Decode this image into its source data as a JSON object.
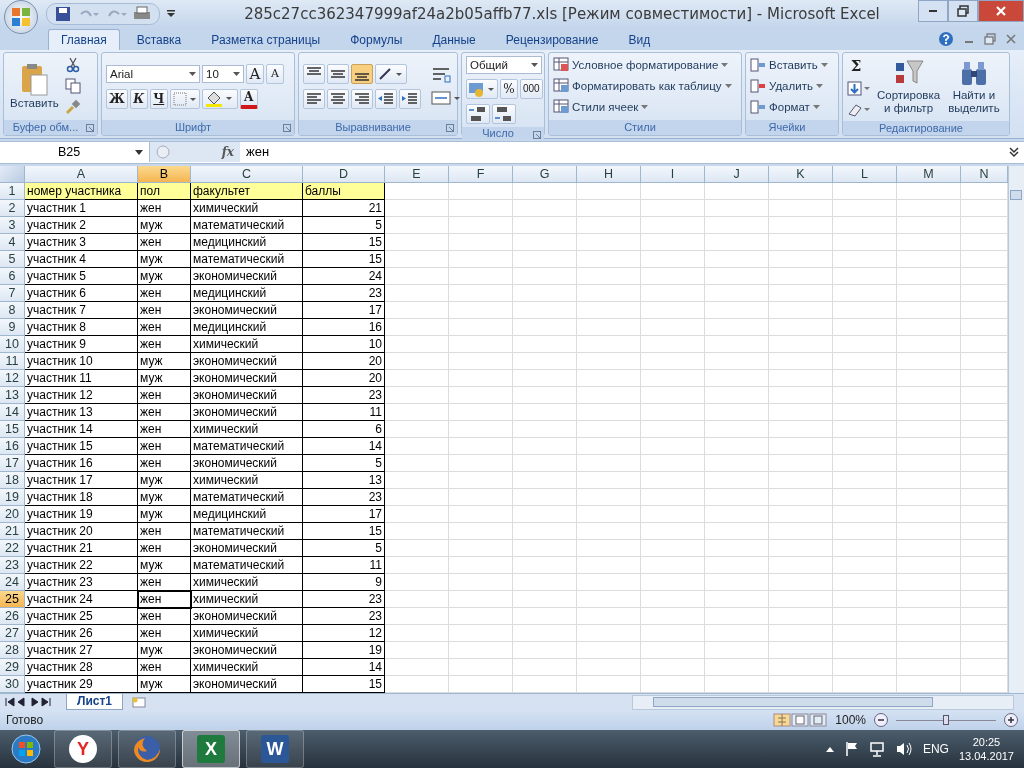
{
  "window": {
    "title": "285c27cc362347999af24a2b05affb77.xls  [Режим совместимости] - Microsoft Excel"
  },
  "ribbon_tabs": [
    {
      "label": "Главная",
      "selected": true
    },
    {
      "label": "Вставка",
      "selected": false
    },
    {
      "label": "Разметка страницы",
      "selected": false
    },
    {
      "label": "Формулы",
      "selected": false
    },
    {
      "label": "Данные",
      "selected": false
    },
    {
      "label": "Рецензирование",
      "selected": false
    },
    {
      "label": "Вид",
      "selected": false
    }
  ],
  "ribbon": {
    "clipboard": {
      "paste": "Вставить",
      "label": "Буфер обм..."
    },
    "font": {
      "family": "Arial",
      "size": "10",
      "grow": "A",
      "shrink": "A",
      "bold": "Ж",
      "italic": "К",
      "underline": "Ч",
      "font_color_letter": "A",
      "label": "Шрифт"
    },
    "alignment": {
      "label": "Выравнивание"
    },
    "number": {
      "format": "Общий",
      "percent": "%",
      "thousands": "000",
      "label": "Число"
    },
    "styles": {
      "items": [
        "Условное форматирование",
        "Форматировать как таблицу",
        "Стили ячеек"
      ],
      "label": "Стили"
    },
    "cells": {
      "items": [
        "Вставить",
        "Удалить",
        "Формат"
      ],
      "label": "Ячейки"
    },
    "editing": {
      "sum": "Σ",
      "sort": [
        "Сортировка",
        "и фильтр"
      ],
      "find": [
        "Найти и",
        "выделить"
      ],
      "label": "Редактирование"
    }
  },
  "formula_bar": {
    "name_box": "B25",
    "fx": "fx",
    "value": "жен"
  },
  "sheet": {
    "columns": [
      {
        "label": "A",
        "selected": false
      },
      {
        "label": "B",
        "selected": true
      },
      {
        "label": "C",
        "selected": false
      },
      {
        "label": "D",
        "selected": false
      },
      {
        "label": "E",
        "selected": false
      },
      {
        "label": "F",
        "selected": false
      },
      {
        "label": "G",
        "selected": false
      },
      {
        "label": "H",
        "selected": false
      },
      {
        "label": "I",
        "selected": false
      },
      {
        "label": "J",
        "selected": false
      },
      {
        "label": "K",
        "selected": false
      },
      {
        "label": "L",
        "selected": false
      },
      {
        "label": "M",
        "selected": false
      },
      {
        "label": "N",
        "selected": false
      }
    ],
    "rows": [
      {
        "number": "1",
        "selected": false,
        "kind": "header",
        "cells": [
          "номер участника",
          "пол",
          "факультет",
          "баллы"
        ]
      },
      {
        "number": "2",
        "selected": false,
        "kind": "data",
        "cells": [
          "участник 1",
          "жен",
          "химический",
          "21"
        ]
      },
      {
        "number": "3",
        "selected": false,
        "kind": "data",
        "cells": [
          "участник 2",
          "муж",
          "математический",
          "5"
        ]
      },
      {
        "number": "4",
        "selected": false,
        "kind": "data",
        "cells": [
          "участник 3",
          "жен",
          "медицинский",
          "15"
        ]
      },
      {
        "number": "5",
        "selected": false,
        "kind": "data",
        "cells": [
          "участник 4",
          "муж",
          "математический",
          "15"
        ]
      },
      {
        "number": "6",
        "selected": false,
        "kind": "data",
        "cells": [
          "участник 5",
          "муж",
          "экономический",
          "24"
        ]
      },
      {
        "number": "7",
        "selected": false,
        "kind": "data",
        "cells": [
          "участник 6",
          "жен",
          "медицинский",
          "23"
        ]
      },
      {
        "number": "8",
        "selected": false,
        "kind": "data",
        "cells": [
          "участник 7",
          "жен",
          "экономический",
          "17"
        ]
      },
      {
        "number": "9",
        "selected": false,
        "kind": "data",
        "cells": [
          "участник 8",
          "жен",
          "медицинский",
          "16"
        ]
      },
      {
        "number": "10",
        "selected": false,
        "kind": "data",
        "cells": [
          "участник 9",
          "жен",
          "химический",
          "10"
        ]
      },
      {
        "number": "11",
        "selected": false,
        "kind": "data",
        "cells": [
          "участник 10",
          "муж",
          "экономический",
          "20"
        ]
      },
      {
        "number": "12",
        "selected": false,
        "kind": "data",
        "cells": [
          "участник 11",
          "муж",
          "экономический",
          "20"
        ]
      },
      {
        "number": "13",
        "selected": false,
        "kind": "data",
        "cells": [
          "участник 12",
          "жен",
          "экономический",
          "23"
        ]
      },
      {
        "number": "14",
        "selected": false,
        "kind": "data",
        "cells": [
          "участник 13",
          "жен",
          "экономический",
          "11"
        ]
      },
      {
        "number": "15",
        "selected": false,
        "kind": "data",
        "cells": [
          "участник 14",
          "жен",
          "химический",
          "6"
        ]
      },
      {
        "number": "16",
        "selected": false,
        "kind": "data",
        "cells": [
          "участник 15",
          "жен",
          "математический",
          "14"
        ]
      },
      {
        "number": "17",
        "selected": false,
        "kind": "data",
        "cells": [
          "участник 16",
          "жен",
          "экономический",
          "5"
        ]
      },
      {
        "number": "18",
        "selected": false,
        "kind": "data",
        "cells": [
          "участник 17",
          "муж",
          "химический",
          "13"
        ]
      },
      {
        "number": "19",
        "selected": false,
        "kind": "data",
        "cells": [
          "участник 18",
          "муж",
          "математический",
          "23"
        ]
      },
      {
        "number": "20",
        "selected": false,
        "kind": "data",
        "cells": [
          "участник 19",
          "муж",
          "медицинский",
          "17"
        ]
      },
      {
        "number": "21",
        "selected": false,
        "kind": "data",
        "cells": [
          "участник 20",
          "жен",
          "математический",
          "15"
        ]
      },
      {
        "number": "22",
        "selected": false,
        "kind": "data",
        "cells": [
          "участник 21",
          "жен",
          "экономический",
          "5"
        ]
      },
      {
        "number": "23",
        "selected": false,
        "kind": "data",
        "cells": [
          "участник 22",
          "муж",
          "математический",
          "11"
        ]
      },
      {
        "number": "24",
        "selected": false,
        "kind": "data",
        "cells": [
          "участник 23",
          "жен",
          "химический",
          "9"
        ]
      },
      {
        "number": "25",
        "selected": true,
        "kind": "data",
        "cells": [
          "участник 24",
          "жен",
          "химический",
          "23"
        ]
      },
      {
        "number": "26",
        "selected": false,
        "kind": "data",
        "cells": [
          "участник 25",
          "жен",
          "экономический",
          "23"
        ]
      },
      {
        "number": "27",
        "selected": false,
        "kind": "data",
        "cells": [
          "участник 26",
          "жен",
          "химический",
          "12"
        ]
      },
      {
        "number": "28",
        "selected": false,
        "kind": "data",
        "cells": [
          "участник 27",
          "муж",
          "экономический",
          "19"
        ]
      },
      {
        "number": "29",
        "selected": false,
        "kind": "data",
        "cells": [
          "участник 28",
          "жен",
          "химический",
          "14"
        ]
      },
      {
        "number": "30",
        "selected": false,
        "kind": "data",
        "cells": [
          "участник 29",
          "муж",
          "экономический",
          "15"
        ]
      }
    ]
  },
  "sheet_tabs": [
    {
      "label": "Лист1",
      "selected": true
    }
  ],
  "status_bar": {
    "text": "Готово",
    "zoom": "100%",
    "zoom_slider": {
      "level": 0.5
    }
  },
  "taskbar": {
    "apps": [
      {
        "kind": "yandex",
        "label": "Y",
        "selected": false
      },
      {
        "kind": "firefox",
        "selected": false
      },
      {
        "kind": "excel",
        "label": "X",
        "selected": true
      },
      {
        "kind": "word",
        "label": "W",
        "selected": false
      }
    ],
    "language": "ENG",
    "time": "20:25",
    "date": "13.04.2017"
  }
}
